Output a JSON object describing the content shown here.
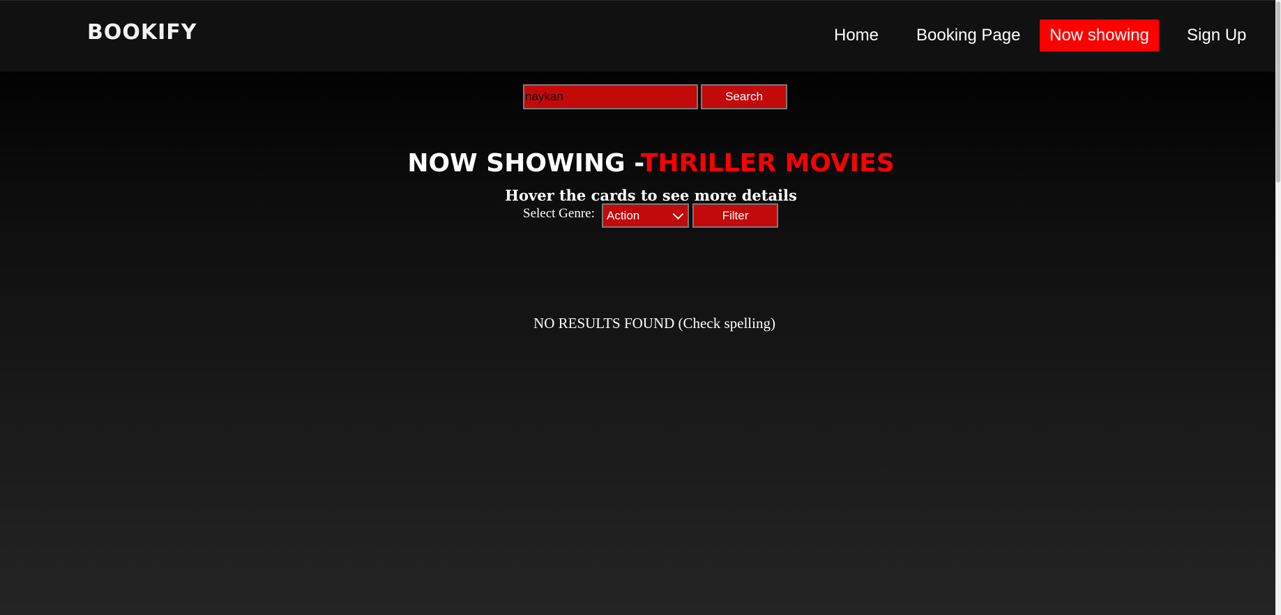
{
  "header": {
    "brand": "BOOKIFY",
    "nav": {
      "home": "Home",
      "booking": "Booking Page",
      "now_showing": "Now showing",
      "sign_up": "Sign Up"
    },
    "active_nav": "Now showing",
    "active_color": "#ff0000"
  },
  "search": {
    "value": "naykan",
    "button_label": "Search"
  },
  "main": {
    "title_prefix": "NOW SHOWING -",
    "title_highlight": "THRILLER MOVIES",
    "subtitle": "Hover the cards to see more details",
    "genre_label": "Select Genre:",
    "genre_selected": "Action",
    "filter_label": "Filter",
    "no_results": "NO RESULTS FOUND (Check spelling)"
  },
  "colors": {
    "accent": "#ff0000",
    "control_bg": "#c20a0a",
    "navbar_bg": "#111111"
  },
  "icons": {
    "dropdown": "chevron-down-icon"
  }
}
